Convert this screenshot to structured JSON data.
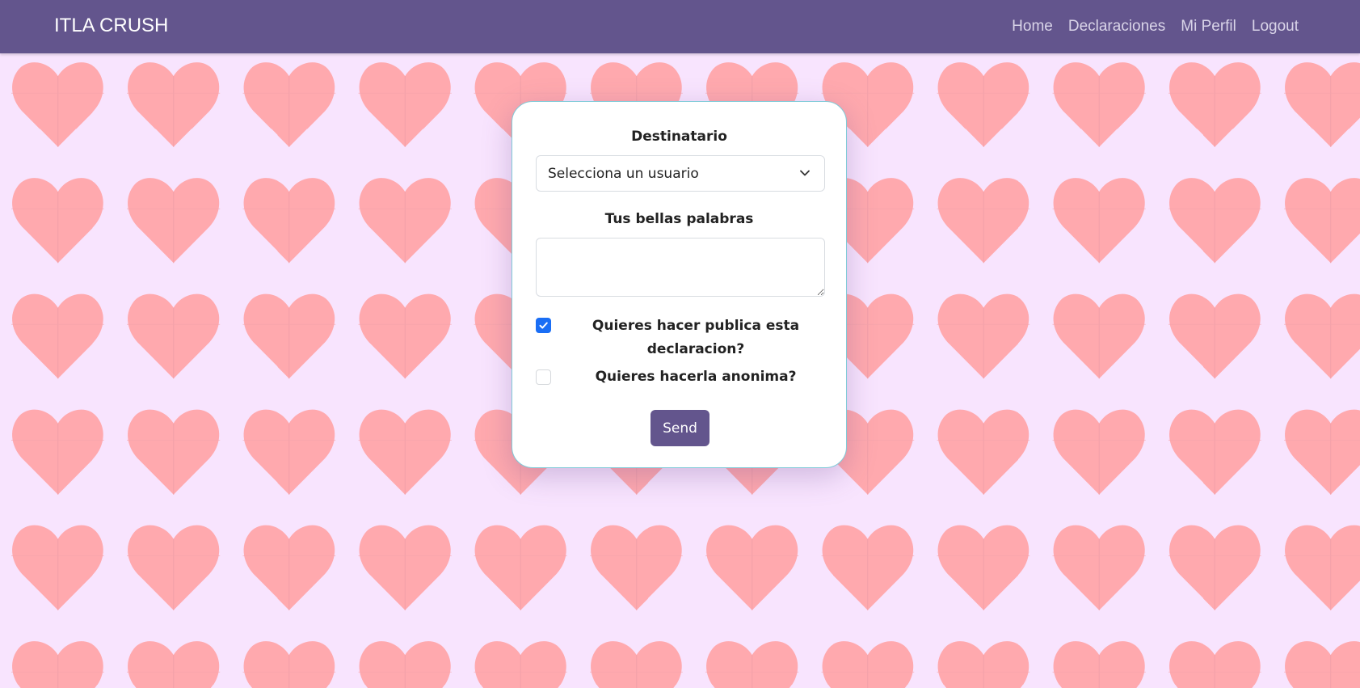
{
  "navbar": {
    "brand": "ITLA CRUSH",
    "links": [
      "Home",
      "Declaraciones",
      "Mi Perfil",
      "Logout"
    ]
  },
  "form": {
    "recipient_label": "Destinatario",
    "recipient_select_value": "Selecciona un usuario",
    "message_label": "Tus bellas palabras",
    "message_value": "",
    "public_checkbox": {
      "label": "Quieres hacer publica esta declaracion?",
      "checked": true
    },
    "anonymous_checkbox": {
      "label": "Quieres hacerla anonima?",
      "checked": false
    },
    "send_label": "Send"
  },
  "colors": {
    "navbar": "#63558d",
    "background": "#f8e4fe",
    "heart": "#ffa9ae",
    "checkbox_accent": "#1a6ef5",
    "card_border": "#7fcad8"
  },
  "icons": {
    "select": "chevron-down-icon",
    "checkbox": "checkmark-icon"
  }
}
